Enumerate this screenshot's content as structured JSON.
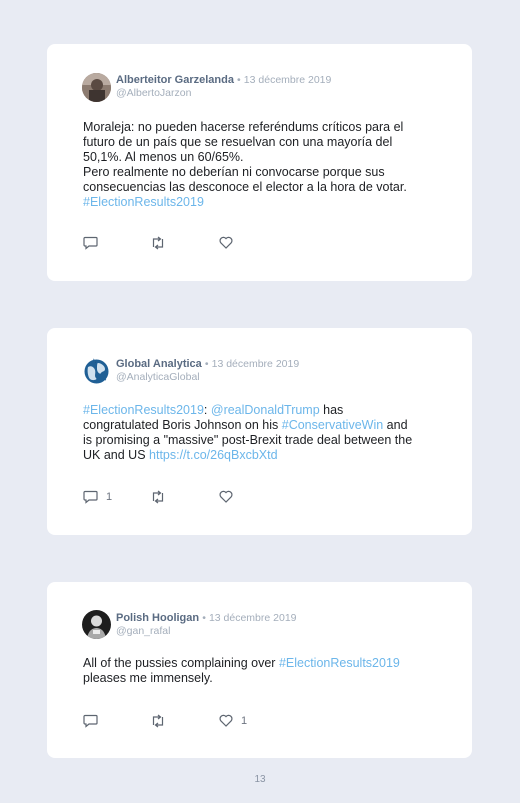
{
  "tweets": [
    {
      "author": "Alberteitor Garzelanda",
      "separator": "•",
      "date": "13 décembre 2019",
      "handle": "@AlbertoJarzon",
      "line1": "Moraleja: no pueden hacerse referéndums críticos para el",
      "line2": "futuro de un país que se resuelvan con una mayoría del",
      "line3": "50,1%. Al menos un 60/65%.",
      "line4": "Pero realmente no deberían ni convocarse porque sus",
      "line5": "consecuencias las desconoce el elector a la hora de votar.",
      "hashtag": "#ElectionResults2019",
      "reply_count": "",
      "retweet_count": "",
      "like_count": ""
    },
    {
      "author": "Global Analytica",
      "separator": "•",
      "date": "13 décembre 2019",
      "handle": "@AnalyticaGlobal",
      "hashtag1": "#ElectionResults2019",
      "colon": ": ",
      "mention": "@realDonaldTrump",
      "text1": " has",
      "text2": "congratulated Boris Johnson on his ",
      "hashtag2": "#ConservativeWin",
      "text3": " and",
      "text4": "is promising a \"massive\" post-Brexit trade deal between the",
      "text5": "UK and US ",
      "url": "https://t.co/26qBxcbXtd",
      "reply_count": "1",
      "retweet_count": "",
      "like_count": ""
    },
    {
      "author": "Polish Hooligan",
      "separator": "•",
      "date": "13 décembre 2019",
      "handle": "@gan_rafal",
      "text1": "All of the pussies complaining over ",
      "hashtag": "#ElectionResults2019",
      "text2": "pleases me immensely.",
      "reply_count": "",
      "retweet_count": "",
      "like_count": "1"
    }
  ],
  "page_number": "13",
  "colors": {
    "background": "#e8ebf3",
    "card": "#ffffff",
    "link": "#6cb6ea",
    "name": "#5a6b82",
    "meta": "#a4aebb"
  },
  "icons": [
    "reply-icon",
    "retweet-icon",
    "like-icon"
  ]
}
